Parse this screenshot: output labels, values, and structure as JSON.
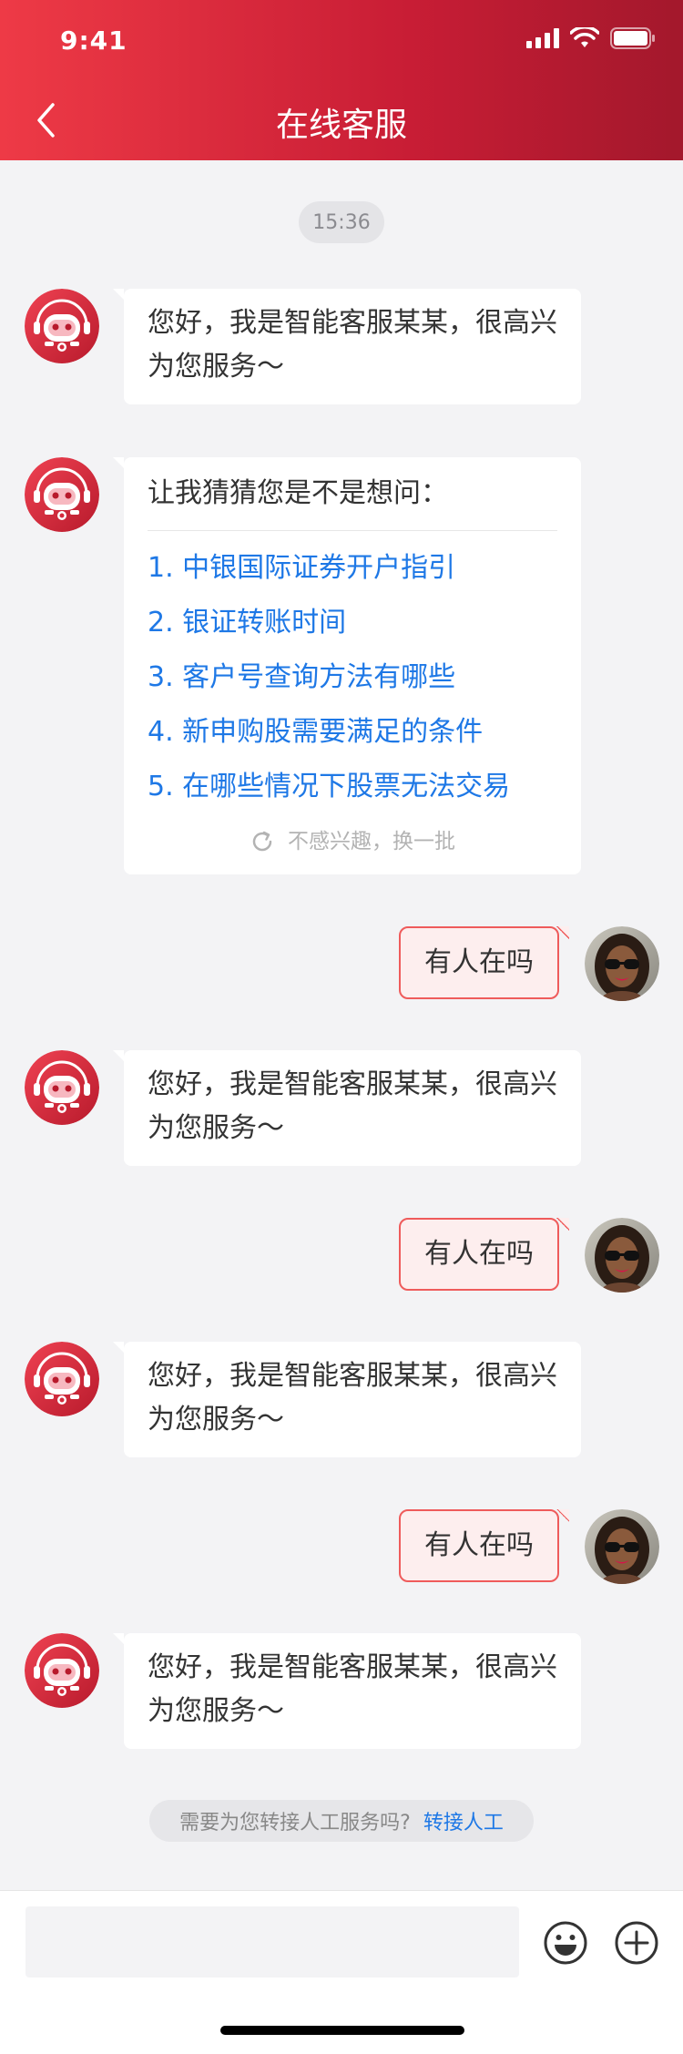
{
  "status_bar": {
    "time": "9:41"
  },
  "header": {
    "title": "在线客服"
  },
  "timestamp": "15:36",
  "greeting": "您好，我是智能客服某某，很高兴为您服务～",
  "guess": {
    "heading": "让我猜猜您是不是想问：",
    "items": [
      "1. 中银国际证券开户指引",
      "2. 银证转账时间",
      "3. 客户号查询方法有哪些",
      "4. 新申购股需要满足的条件",
      "5. 在哪些情况下股票无法交易"
    ],
    "refresh_label": "不感兴趣，换一批"
  },
  "user_message": "有人在吗",
  "transfer": {
    "prompt": "需要为您转接人工服务吗?",
    "link": "转接人工"
  },
  "composer": {
    "placeholder": ""
  },
  "colors": {
    "brand_red": "#d42a3c",
    "link_blue": "#1e78e6",
    "user_bubble_bg": "#fdeeee",
    "user_bubble_border": "#ef5b5b"
  },
  "icons": {
    "back": "chevron-left-icon",
    "refresh": "refresh-icon",
    "emoji": "smiley-icon",
    "plus": "plus-circle-icon"
  }
}
